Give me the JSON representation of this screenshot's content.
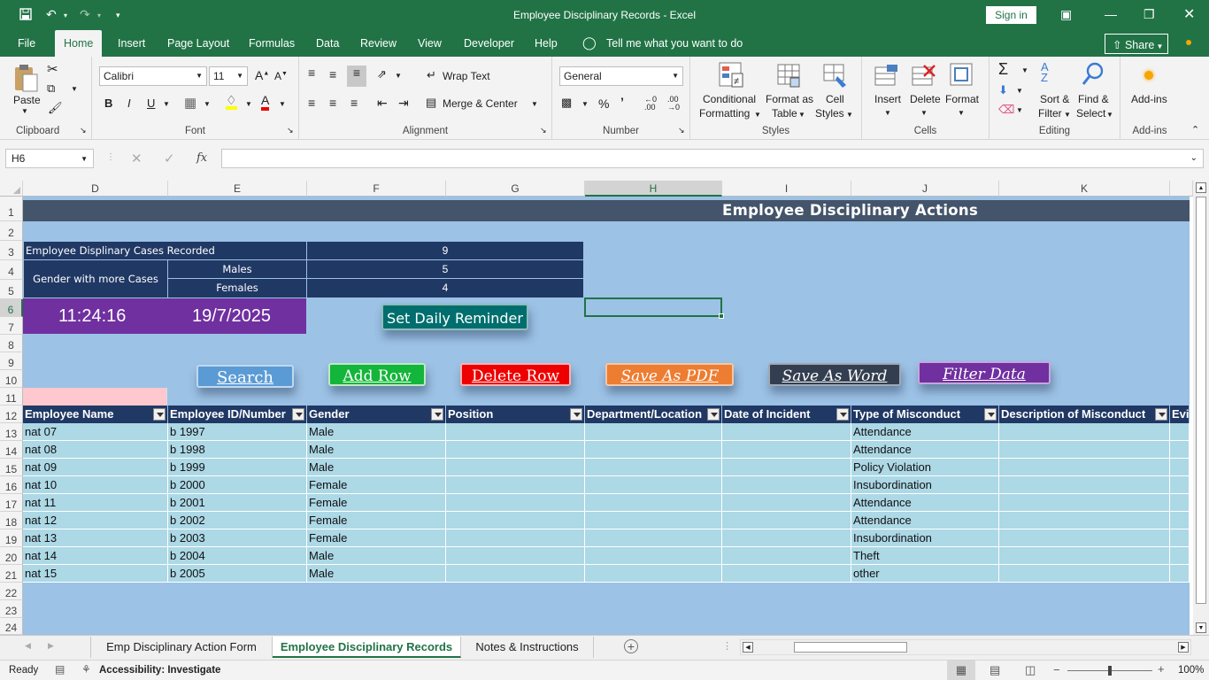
{
  "window": {
    "title": "Employee Disciplinary Records  -  Excel",
    "signin": "Sign in"
  },
  "menu": {
    "tabs": [
      "File",
      "Home",
      "Insert",
      "Page Layout",
      "Formulas",
      "Data",
      "Review",
      "View",
      "Developer",
      "Help"
    ],
    "tell": "Tell me what you want to do",
    "share": "Share"
  },
  "ribbon": {
    "clipboard": {
      "paste": "Paste",
      "label": "Clipboard"
    },
    "font": {
      "name": "Calibri",
      "size": "11",
      "label": "Font"
    },
    "alignment": {
      "wrap": "Wrap Text",
      "merge": "Merge & Center",
      "label": "Alignment"
    },
    "number": {
      "format": "General",
      "label": "Number"
    },
    "styles": {
      "cond1": "Conditional",
      "cond2": "Formatting",
      "fmt1": "Format as",
      "fmt2": "Table",
      "cell1": "Cell",
      "cell2": "Styles",
      "label": "Styles"
    },
    "cells": {
      "insert": "Insert",
      "delete": "Delete",
      "format": "Format",
      "label": "Cells"
    },
    "editing": {
      "sort1": "Sort &",
      "sort2": "Filter",
      "find1": "Find &",
      "find2": "Select",
      "label": "Editing"
    },
    "addins": {
      "name": "Add-ins",
      "label": "Add-ins"
    }
  },
  "formula": {
    "namebox": "H6",
    "value": ""
  },
  "columns": [
    "D",
    "E",
    "F",
    "G",
    "H",
    "I",
    "J",
    "K"
  ],
  "rows": [
    "1",
    "2",
    "3",
    "4",
    "5",
    "6",
    "7",
    "8",
    "9",
    "10",
    "11",
    "12",
    "13",
    "14",
    "15",
    "16",
    "17",
    "18",
    "19",
    "20",
    "21",
    "22",
    "23",
    "24"
  ],
  "banner": "Employee Disciplinary Actions",
  "summary": {
    "cases_label": "Employee Displinary Cases Recorded",
    "cases": "9",
    "gender_label": "Gender with more Cases",
    "males_label": "Males",
    "males": "5",
    "females_label": "Females",
    "females": "4"
  },
  "clock": {
    "time": "11:24:16",
    "date": "19/7/2025"
  },
  "buttons": {
    "reminder": "Set Daily Reminder",
    "search": "Search",
    "add": "Add Row",
    "delete": "Delete Row",
    "pdf": "Save As PDF",
    "word": "Save As Word",
    "filter": "Filter Data"
  },
  "table": {
    "headers": [
      "Employee Name",
      "Employee ID/Number",
      "Gender",
      "Position",
      "Department/Location",
      "Date of Incident",
      "Type of Misconduct",
      "Description of Misconduct",
      "Evi"
    ],
    "rows": [
      [
        "nat 07",
        "b 1997",
        "Male",
        "",
        "",
        "",
        "Attendance",
        ""
      ],
      [
        "nat 08",
        "b 1998",
        "Male",
        "",
        "",
        "",
        "Attendance",
        ""
      ],
      [
        "nat 09",
        "b 1999",
        "Male",
        "",
        "",
        "",
        "Policy Violation",
        ""
      ],
      [
        "nat 10",
        "b 2000",
        "Female",
        "",
        "",
        "",
        "Insubordination",
        ""
      ],
      [
        "nat 11",
        "b 2001",
        "Female",
        "",
        "",
        "",
        "Attendance",
        ""
      ],
      [
        "nat 12",
        "b 2002",
        "Female",
        "",
        "",
        "",
        "Attendance",
        ""
      ],
      [
        "nat 13",
        "b 2003",
        "Female",
        "",
        "",
        "",
        "Insubordination",
        ""
      ],
      [
        "nat 14",
        "b 2004",
        "Male",
        "",
        "",
        "",
        "Theft",
        ""
      ],
      [
        "nat 15",
        "b 2005",
        "Male",
        "",
        "",
        "",
        "other",
        ""
      ]
    ]
  },
  "sheets": [
    "Emp Disciplinary Action Form",
    "Employee Disciplinary Records",
    "Notes & Instructions"
  ],
  "status": {
    "ready": "Ready",
    "access": "Accessibility: Investigate",
    "zoom": "100%"
  },
  "colors": {
    "excel_green": "#217346",
    "sheet_bg": "#9cc2e5",
    "header_navy": "#203864",
    "row_fill": "#add8e6"
  }
}
